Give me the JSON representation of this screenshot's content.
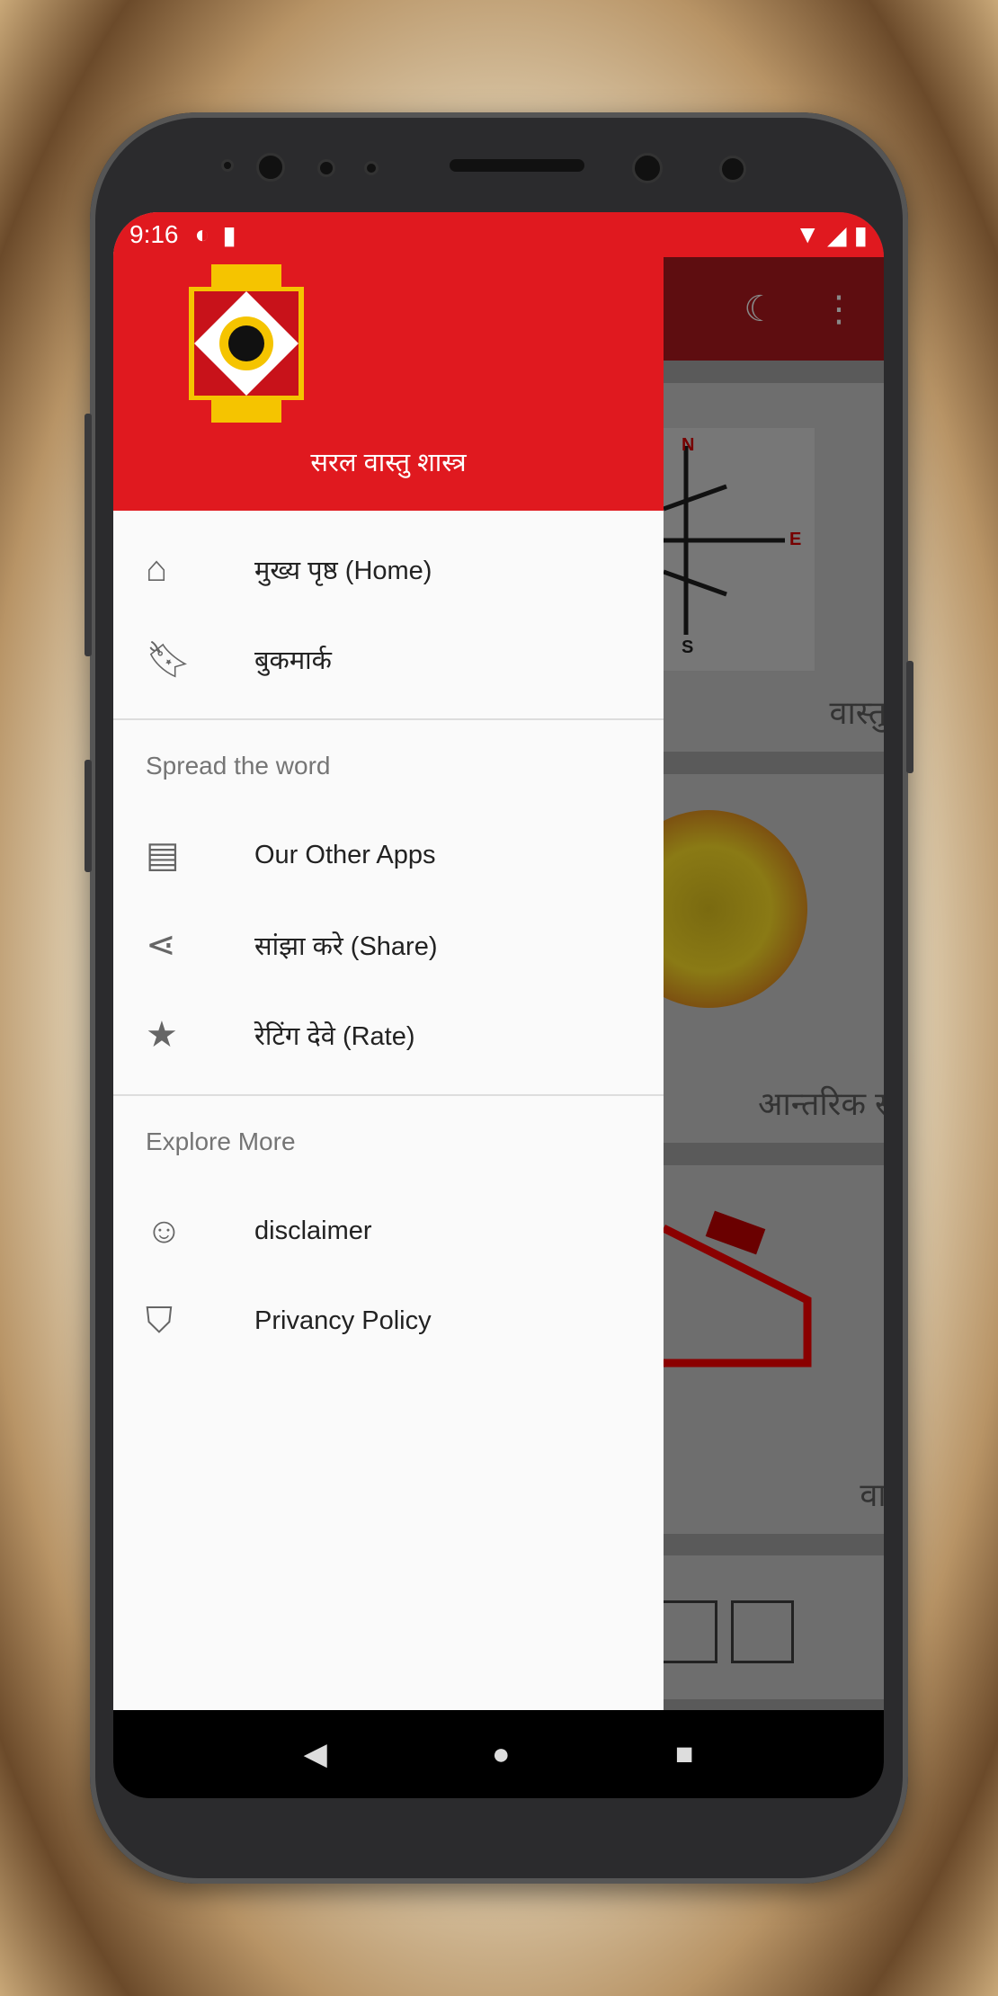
{
  "status_bar": {
    "time": "9:16"
  },
  "drawer": {
    "title": "सरल वास्तु शास्त्र",
    "items": [
      {
        "label": "मुख्य पृष्ठ (Home)",
        "icon": "home-icon"
      },
      {
        "label": "बुकमार्क",
        "icon": "bookmarks-icon"
      }
    ],
    "section_spread": "Spread the word",
    "spread_items": [
      {
        "label": "Our Other Apps",
        "icon": "store-icon"
      },
      {
        "label": "सांझा करे (Share)",
        "icon": "share-icon"
      },
      {
        "label": "रेटिंग देवे (Rate)",
        "icon": "star-icon"
      }
    ],
    "section_explore": "Explore More",
    "explore_items": [
      {
        "label": "disclaimer",
        "icon": "smiley-icon"
      },
      {
        "label": "Privancy Policy",
        "icon": "shield-info-icon"
      }
    ]
  },
  "background_cards": [
    "वास्तुशास्त्र",
    "आन्तरिक सज्जा",
    "वास्तुशा"
  ],
  "colors": {
    "primary": "#e0191f",
    "scrim_appbar": "#5e0d10"
  }
}
